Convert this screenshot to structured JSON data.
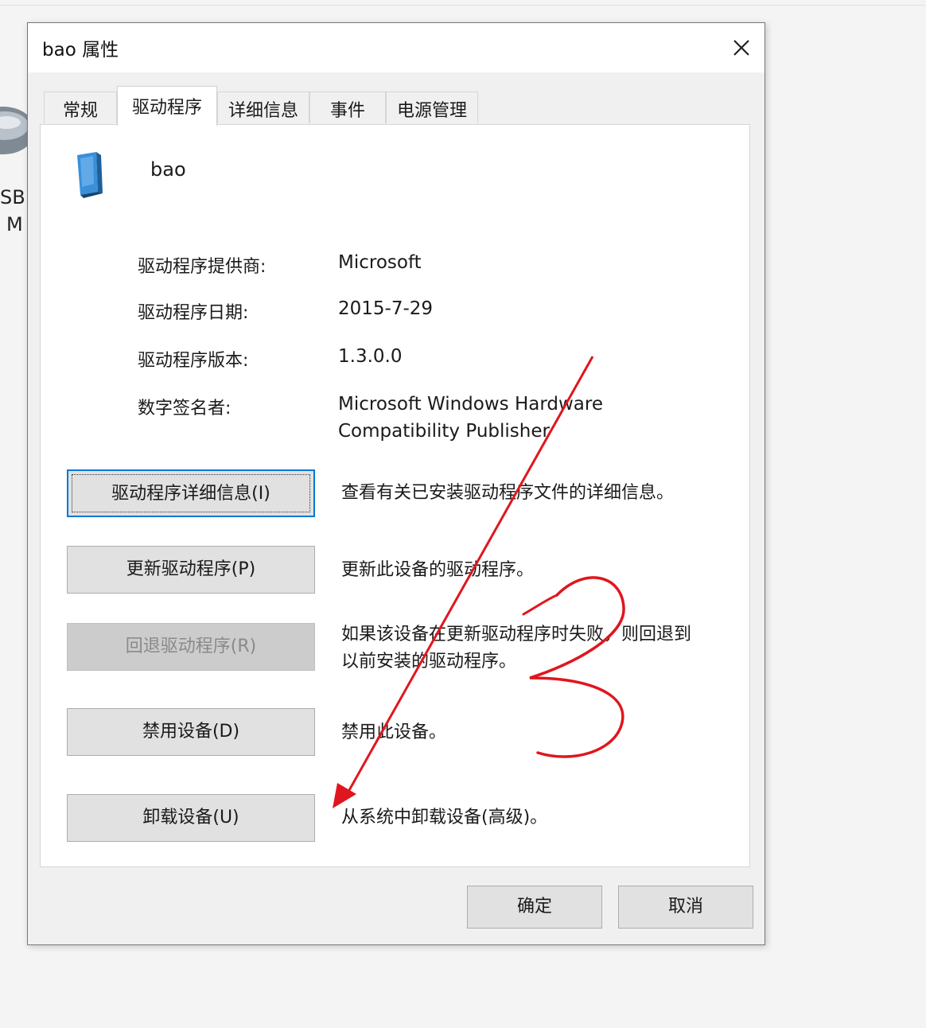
{
  "background": {
    "fragment_line1": "SB",
    "fragment_line2": "M"
  },
  "dialog": {
    "title": "bao 属性",
    "tabs": [
      "常规",
      "驱动程序",
      "详细信息",
      "事件",
      "电源管理"
    ],
    "active_tab": "驱动程序",
    "device_name": "bao",
    "info": {
      "provider_label": "驱动程序提供商:",
      "provider_value": "Microsoft",
      "date_label": "驱动程序日期:",
      "date_value": "2015-7-29",
      "version_label": "驱动程序版本:",
      "version_value": "1.3.0.0",
      "signer_label": "数字签名者:",
      "signer_value_line1": "Microsoft Windows Hardware",
      "signer_value_line2": "Compatibility Publisher"
    },
    "actions": {
      "details_button": "驱动程序详细信息(I)",
      "details_desc": "查看有关已安装驱动程序文件的详细信息。",
      "update_button": "更新驱动程序(P)",
      "update_desc": "更新此设备的驱动程序。",
      "rollback_button": "回退驱动程序(R)",
      "rollback_desc_line1": "如果该设备在更新驱动程序时失败，则回退到",
      "rollback_desc_line2": "以前安装的驱动程序。",
      "disable_button": "禁用设备(D)",
      "disable_desc": "禁用此设备。",
      "uninstall_button": "卸载设备(U)",
      "uninstall_desc": "从系统中卸载设备(高级)。"
    },
    "ok_button": "确定",
    "cancel_button": "取消"
  },
  "annotation": {
    "color": "#e0161e",
    "number": "3",
    "arrow_target": "卸载设备(U)"
  },
  "colors": {
    "focus_border": "#0078d7",
    "button_face": "#e1e1e1",
    "device_icon": "#3a8fd9"
  }
}
